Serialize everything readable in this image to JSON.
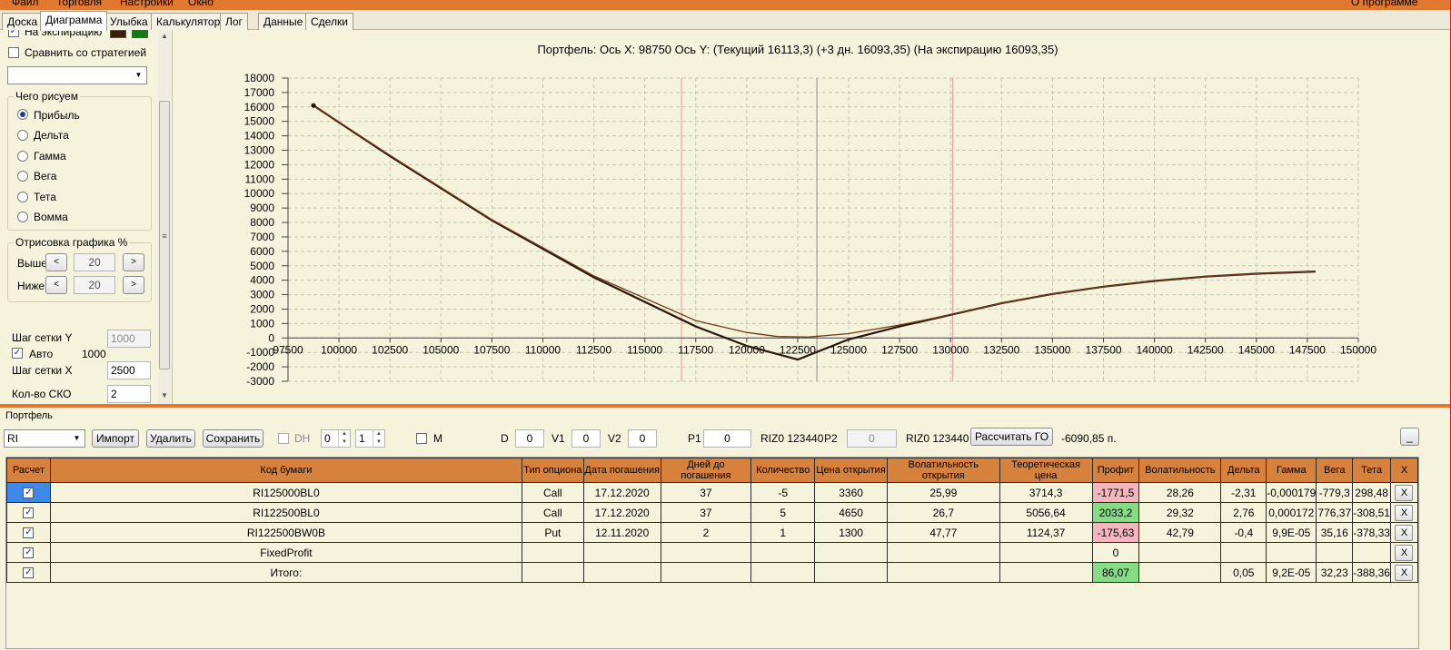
{
  "menu": {
    "items": [
      "Файл",
      "Торговля",
      "Настройки",
      "Окно"
    ],
    "about": "О программе"
  },
  "tabs": [
    {
      "label": "Доска"
    },
    {
      "label": "Диаграмма",
      "active": true
    },
    {
      "label": "Улыбка"
    },
    {
      "label": "Калькулятор"
    },
    {
      "label": "Лог"
    },
    {
      "label": "Данные"
    },
    {
      "label": "Сделки"
    }
  ],
  "left_panel": {
    "expiration_label": "На экспирацию",
    "expiration_checked": true,
    "legend_colors": [
      "#3a1e0c",
      "#0f7d0f"
    ],
    "compare_label": "Сравнить со стратегией",
    "compare_checked": false,
    "strategy_value": "",
    "draw_group_title": "Чего рисуем",
    "draw_options": [
      "Прибыль",
      "Дельта",
      "Гамма",
      "Вега",
      "Тета",
      "Вомма"
    ],
    "draw_selected": "Прибыль",
    "render_group_title": "Отрисовка графика %",
    "above_label": "Выше",
    "above_value": "20",
    "below_label": "Ниже",
    "below_value": "20",
    "dec_symbol": "<",
    "inc_symbol": ">",
    "grid_y_label": "Шаг сетки Y",
    "grid_y_value": "1000",
    "auto_label": "Авто",
    "auto_checked": true,
    "auto_value": "1000",
    "grid_x_label": "Шаг сетки X",
    "grid_x_value": "2500",
    "sko_label": "Кол-во СКО",
    "sko_value": "2"
  },
  "chart_title": "Портфель:  Ось X:  98750  Ось Y:   (Текущий  16113,3)   (+3 дн.  16093,35)   (На экспирацию  16093,35)",
  "chart_data": {
    "type": "line",
    "xlim": [
      97500,
      150000
    ],
    "ylim": [
      -3000,
      18000
    ],
    "x_ticks": [
      97500,
      100000,
      102500,
      105000,
      107500,
      110000,
      112500,
      115000,
      117500,
      120000,
      122500,
      125000,
      127500,
      130000,
      132500,
      135000,
      137500,
      140000,
      142500,
      145000,
      147500,
      150000
    ],
    "y_ticks": [
      18000,
      17000,
      16000,
      15000,
      14000,
      13000,
      12000,
      11000,
      10000,
      9000,
      8000,
      7000,
      6000,
      5000,
      4000,
      3000,
      2000,
      1000,
      0,
      -1000,
      -2000,
      -3000
    ],
    "grid": true,
    "vertical_lines": [
      {
        "x": 116800,
        "color": "#f0a0a8"
      },
      {
        "x": 123440,
        "color": "#9a9a9a"
      },
      {
        "x": 130100,
        "color": "#f0a0a8"
      }
    ],
    "series": [
      {
        "color": "#2a1509",
        "x": [
          98750,
          102500,
          107500,
          112500,
          117500,
          120000,
          122500,
          125000,
          127500,
          130000,
          132500,
          135000,
          137500,
          140000,
          142500,
          145000,
          147900
        ],
        "values": [
          16100,
          12600,
          8150,
          4200,
          800,
          -550,
          -1500,
          -100,
          800,
          1600,
          2400,
          3050,
          3550,
          3950,
          4250,
          4450,
          4600
        ]
      },
      {
        "color": "#6e3a1a",
        "x": [
          98750,
          102500,
          107500,
          112500,
          117500,
          120000,
          121500,
          123000,
          125000,
          127500,
          130000,
          132500,
          135000,
          137500,
          140000,
          142500,
          145000,
          147900
        ],
        "values": [
          16100,
          12650,
          8200,
          4300,
          1200,
          380,
          100,
          60,
          300,
          900,
          1600,
          2400,
          3050,
          3550,
          3950,
          4250,
          4450,
          4600
        ]
      }
    ],
    "marker": {
      "x": 98750,
      "y": 16100
    }
  },
  "portfolio": {
    "title": "Портфель",
    "ticker": "RI",
    "import_label": "Импорт",
    "delete_label": "Удалить",
    "save_label": "Сохранить",
    "dh_label": "DH",
    "dh_checked": false,
    "spin1_value": "0",
    "spin2_value": "1",
    "m_label": "M",
    "m_checked": false,
    "d_label": "D",
    "d_value": "0",
    "v1_label": "V1",
    "v1_value": "0",
    "v2_label": "V2",
    "v2_value": "0",
    "p1_label": "P1",
    "p1_value": "0",
    "p1_instrument": "RIZ0 123440",
    "p2_label": "P2",
    "p2_value": "0",
    "p2_instrument": "RIZ0 123440",
    "calc_go_label": "Рассчитать ГО",
    "go_value": "-6090,85 п.",
    "minimize_label": "_"
  },
  "table": {
    "headers": [
      "Расчет",
      "Код бумаги",
      "Тип опциона",
      "Дата погашения",
      "Дней до погашения",
      "Количество",
      "Цена открытия",
      "Волатильность открытия",
      "Теоретическая цена",
      "Профит",
      "Волатильность",
      "Дельта",
      "Гамма",
      "Вега",
      "Тета",
      "X"
    ],
    "delete_symbol": "X",
    "rows": [
      {
        "checked": true,
        "code": "RI125000BL0",
        "type": "Call",
        "date": "17.12.2020",
        "days": "37",
        "qty": "-5",
        "open_price": "3360",
        "open_vol": "25,99",
        "theor": "3714,3",
        "profit": "-1771,5",
        "profit_sign": "neg",
        "vol": "28,26",
        "delta": "-2,31",
        "gamma": "-0,000179",
        "vega": "-779,3",
        "theta": "298,48",
        "selected": true
      },
      {
        "checked": true,
        "code": "RI122500BL0",
        "type": "Call",
        "date": "17.12.2020",
        "days": "37",
        "qty": "5",
        "open_price": "4650",
        "open_vol": "26,7",
        "theor": "5056,64",
        "profit": "2033,2",
        "profit_sign": "pos",
        "vol": "29,32",
        "delta": "2,76",
        "gamma": "0,000172",
        "vega": "776,37",
        "theta": "-308,51"
      },
      {
        "checked": true,
        "code": "RI122500BW0B",
        "type": "Put",
        "date": "12.11.2020",
        "days": "2",
        "qty": "1",
        "open_price": "1300",
        "open_vol": "47,77",
        "theor": "1124,37",
        "profit": "-175,63",
        "profit_sign": "neg",
        "vol": "42,79",
        "delta": "-0,4",
        "gamma": "9,9E-05",
        "vega": "35,16",
        "theta": "-378,33"
      },
      {
        "checked": true,
        "code": "FixedProfit",
        "type": "",
        "date": "",
        "days": "",
        "qty": "",
        "open_price": "",
        "open_vol": "",
        "theor": "",
        "profit": "0",
        "profit_sign": "",
        "vol": "",
        "delta": "",
        "gamma": "",
        "vega": "",
        "theta": ""
      },
      {
        "checked": true,
        "code": "Итого:",
        "type": "",
        "date": "",
        "days": "",
        "qty": "",
        "open_price": "",
        "open_vol": "",
        "theor": "",
        "profit": "86,07",
        "profit_sign": "pos",
        "vol": "",
        "delta": "0,05",
        "gamma": "9,2E-05",
        "vega": "32,23",
        "theta": "-388,36"
      }
    ]
  }
}
